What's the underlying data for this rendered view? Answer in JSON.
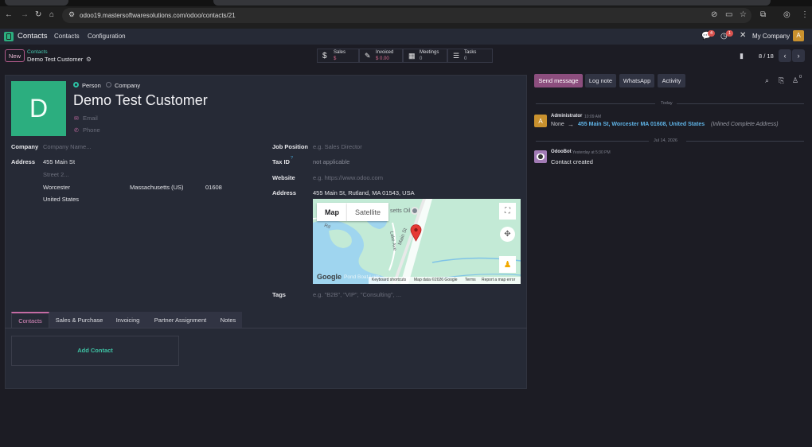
{
  "browser": {
    "url": "odoo19.mastersoftwaresolutions.com/odoo/contacts/21"
  },
  "topbar": {
    "app_name": "Contacts",
    "menu_contacts": "Contacts",
    "menu_configuration": "Configuration",
    "messages_badge": "4",
    "activities_badge": "1",
    "company_name": "My Company",
    "company_avatar_letter": "A"
  },
  "control_panel": {
    "new_label": "New",
    "breadcrumb_parent": "Contacts",
    "record_name": "Demo Test Customer",
    "pager": "8 / 18",
    "stats": [
      {
        "icon": "dollar-icon",
        "label": "Sales",
        "value": "$"
      },
      {
        "icon": "invoice-icon",
        "label": "Invoiced",
        "value": "$ 0.00"
      },
      {
        "icon": "calendar-icon",
        "label": "Meetings",
        "value": "0"
      },
      {
        "icon": "tasks-icon",
        "label": "Tasks",
        "value": "0"
      }
    ]
  },
  "form": {
    "avatar_letter": "D",
    "avatar_color": "#2cae7f",
    "type_person": "Person",
    "type_company": "Company",
    "name": "Demo Test Customer",
    "email_placeholder": "Email",
    "phone_placeholder": "Phone",
    "company_label": "Company",
    "company_placeholder": "Company Name...",
    "address_label": "Address",
    "street": "455 Main St",
    "street2_placeholder": "Street 2...",
    "city": "Worcester",
    "state": "Massachusetts (US)",
    "zip": "01608",
    "country": "United States",
    "job_label": "Job Position",
    "job_placeholder": "e.g. Sales Director",
    "taxid_label": "Tax ID",
    "taxid_help": "?",
    "taxid_value": "not applicable",
    "website_label": "Website",
    "website_placeholder": "e.g. https://www.odoo.com",
    "address2_label": "Address",
    "address2_value": "455 Main St, Rutland, MA 01543, USA",
    "tags_label": "Tags",
    "tags_placeholder": "e.g. \"B2B\", \"VIP\", \"Consulting\", ..."
  },
  "map": {
    "btn_map": "Map",
    "btn_satellite": "Satellite",
    "poi_text": "setts Oil",
    "road_main": "Main St",
    "road_lake": "Lake Ave",
    "road_rd": "Rd",
    "footer_google": "Google",
    "footer_pond": "Pond Boat Lum",
    "footer_shortcuts": "Keyboard shortcuts",
    "footer_data": "Map data ©2026 Google",
    "footer_terms": "Terms",
    "footer_report": "Report a map error"
  },
  "tabs": [
    "Contacts",
    "Sales & Purchase",
    "Invoicing",
    "Partner Assignment",
    "Notes"
  ],
  "add_contact_label": "Add Contact",
  "chatter": {
    "send_message": "Send message",
    "log_note": "Log note",
    "whatsapp": "WhatsApp",
    "activity": "Activity",
    "followers_count": "0",
    "today_label": "Today",
    "msg1_author": "Administrator",
    "msg1_time": "10:09 AM",
    "msg1_avatar": "A",
    "msg1_old": "None",
    "msg1_arrow": "→",
    "msg1_new": "455 Main St, Worcester MA 01608, United States",
    "msg1_field": "(Inlined Complete Address)",
    "date2_label": "Jul 14, 2026",
    "msg2_author": "OdooBot",
    "msg2_time": "Yesterday at 5:30 PM",
    "msg2_body": "Contact created"
  }
}
